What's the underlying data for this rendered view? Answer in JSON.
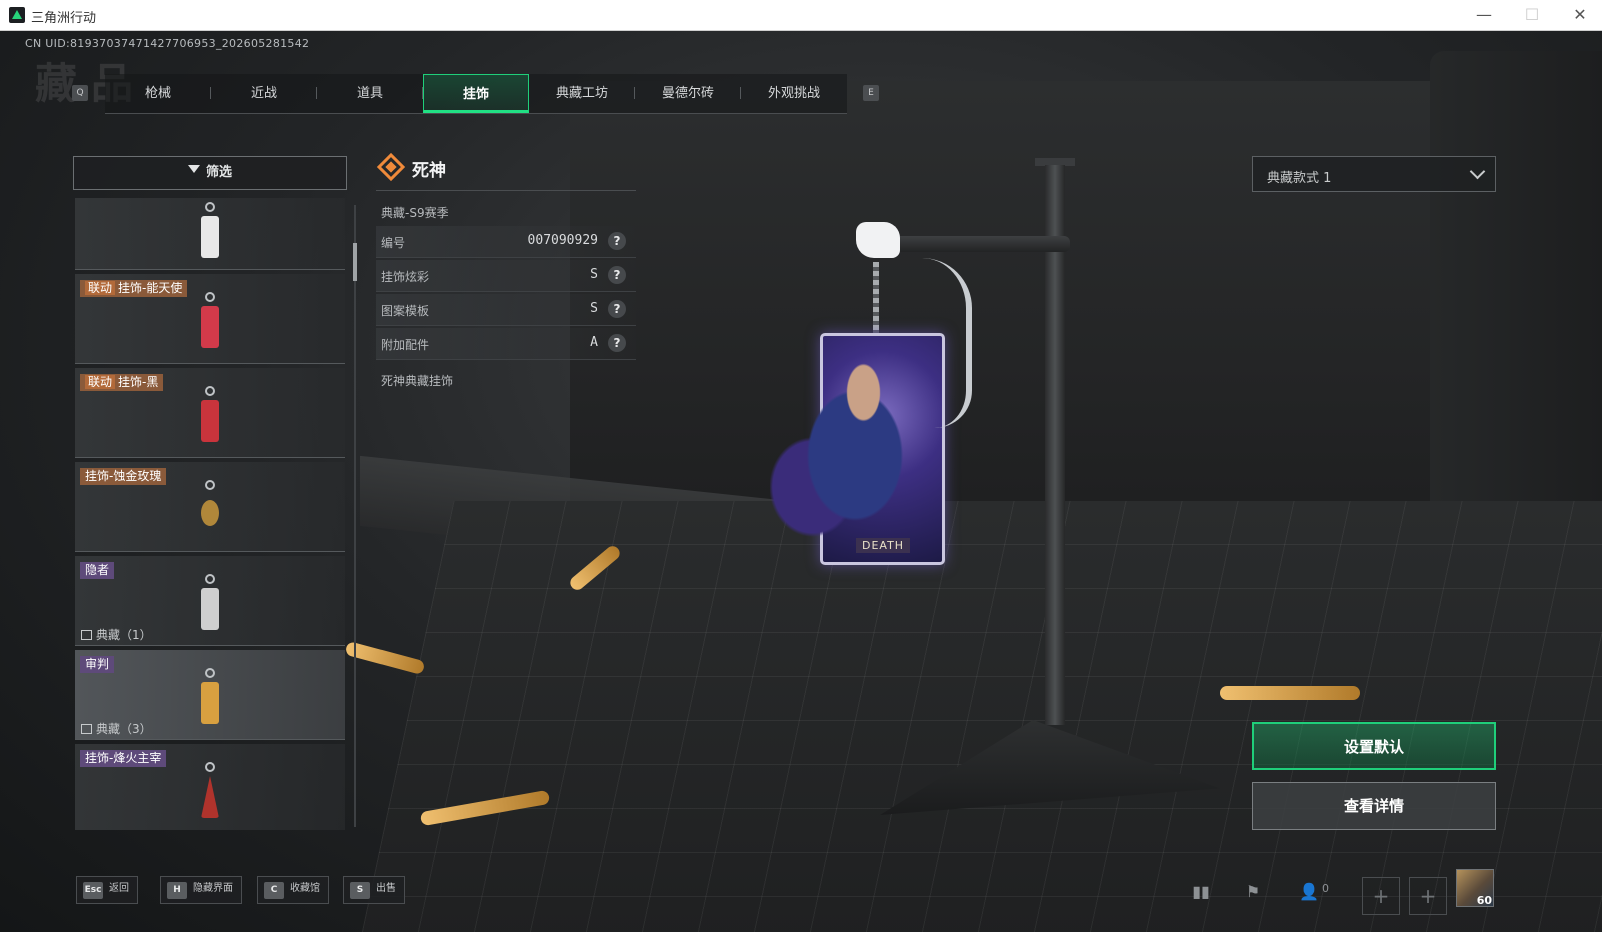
{
  "window": {
    "title": "三角洲行动",
    "controls": {
      "minimize": "—",
      "maximize": "☐",
      "close": "✕"
    }
  },
  "uid_text": "CN UID:8193703747142770695​3_202605281542",
  "page_watermark": "藏品",
  "tabs": {
    "prev_key": "Q",
    "next_key": "E",
    "items": [
      {
        "label": "枪械",
        "active": false
      },
      {
        "label": "近战",
        "active": false
      },
      {
        "label": "道具",
        "active": false
      },
      {
        "label": "挂饰",
        "active": true
      },
      {
        "label": "典藏工坊",
        "active": false
      },
      {
        "label": "曼德尔砖",
        "active": false
      },
      {
        "label": "外观挑战",
        "active": false
      }
    ]
  },
  "filter": {
    "label": "筛选",
    "icon": "filter-icon"
  },
  "list": {
    "items": [
      {
        "badge_tag": "",
        "badge": "",
        "color": "#e8e8e8",
        "collection": "",
        "selected": false
      },
      {
        "badge_tag": "联动",
        "badge": "挂饰-能天使",
        "color": "#d23a4a",
        "collection": "",
        "selected": false
      },
      {
        "badge_tag": "联动",
        "badge": "挂饰-黑",
        "color": "#c9343c",
        "collection": "",
        "selected": false
      },
      {
        "badge_tag": "",
        "badge": "挂饰-蚀金玫瑰",
        "color": "#b0873a",
        "collection": "",
        "selected": false
      },
      {
        "badge_tag": "",
        "badge": "隐者",
        "color": "#cfcfcf",
        "collection": "典藏（1）",
        "selected": false
      },
      {
        "badge_tag": "",
        "badge": "审判",
        "color": "#d8a040",
        "collection": "典藏（3）",
        "selected": true
      },
      {
        "badge_tag": "",
        "badge": "挂饰-烽火主宰",
        "color": "#b0332c",
        "collection": "",
        "selected": false
      }
    ]
  },
  "detail": {
    "name": "死神",
    "season": "典藏-S9赛季",
    "attributes": [
      {
        "key": "编号",
        "value": "007090929"
      },
      {
        "key": "挂饰炫彩",
        "value": "S"
      },
      {
        "key": "图案模板",
        "value": "S"
      },
      {
        "key": "附加配件",
        "value": "A"
      }
    ],
    "help_symbol": "?",
    "description": "死神典藏挂饰",
    "card_label": "DEATH"
  },
  "variant_select": {
    "value": "典藏款式 1"
  },
  "actions": {
    "set_default": "设置默认",
    "view_details": "查看详情"
  },
  "bottom_hotkeys": [
    {
      "key": "Esc",
      "label": "返回"
    },
    {
      "key": "H",
      "label": "隐藏界面"
    },
    {
      "key": "C",
      "label": "收藏馆"
    },
    {
      "key": "S",
      "label": "出售"
    }
  ],
  "tray": {
    "friends_count": "0",
    "slot_symbol": "+",
    "avatar_level": "60"
  },
  "colors": {
    "accent": "#1fcf7a",
    "brand_orange": "#f08a3a"
  }
}
